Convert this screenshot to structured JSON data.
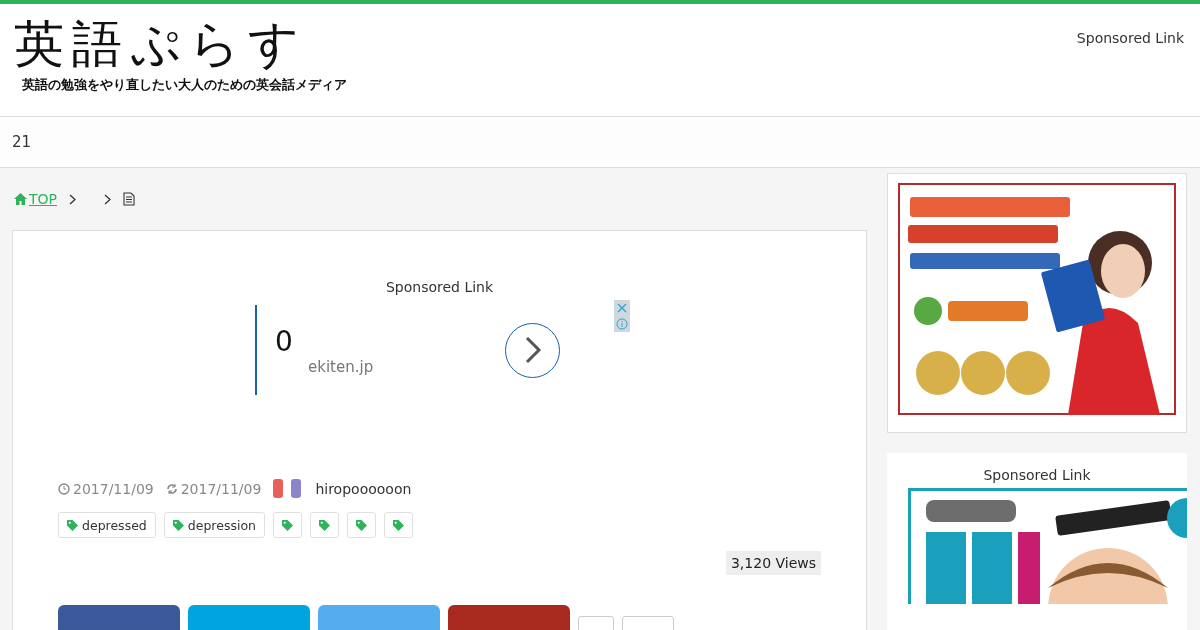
{
  "header": {
    "logo": "英語ぷらす",
    "tagline": "英語の勉強をやり直したい大人のための英会話メディア",
    "sponsored": "Sponsored Link"
  },
  "nav": {
    "label": "21"
  },
  "breadcrumb": {
    "home": "TOP"
  },
  "article": {
    "ad": {
      "heading": "Sponsored Link",
      "title": "0",
      "domain": "ekiten.jp"
    },
    "published": "2017/11/09",
    "updated": "2017/11/09",
    "categories": [
      {
        "color": "#e8605a"
      },
      {
        "color": "#8a85cc"
      }
    ],
    "author": "hiropoooooon",
    "tags": [
      {
        "kind": "labeled",
        "label": "depressed"
      },
      {
        "kind": "labeled",
        "label": "depression"
      },
      {
        "kind": "icon_only"
      },
      {
        "kind": "icon_only"
      },
      {
        "kind": "icon_only"
      },
      {
        "kind": "icon_only"
      }
    ],
    "views": "3,120 Views",
    "share_buttons": [
      {
        "color": "#3b5998"
      },
      {
        "color": "#00a4de"
      },
      {
        "color": "#55acee"
      },
      {
        "color": "#a8291d"
      }
    ],
    "count_boxes": [
      {
        "kind": "narrow"
      },
      {
        "kind": "wide"
      }
    ]
  },
  "sidebar": {
    "widget": {
      "heading": "Sponsored Link"
    }
  }
}
